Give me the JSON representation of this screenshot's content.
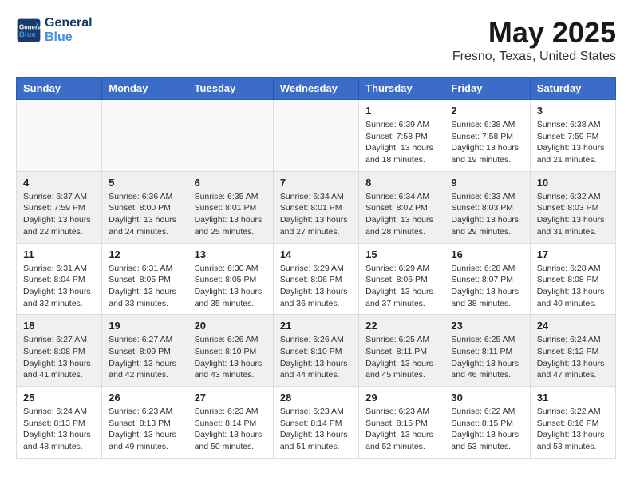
{
  "header": {
    "logo_line1": "General",
    "logo_line2": "Blue",
    "title": "May 2025",
    "subtitle": "Fresno, Texas, United States"
  },
  "weekdays": [
    "Sunday",
    "Monday",
    "Tuesday",
    "Wednesday",
    "Thursday",
    "Friday",
    "Saturday"
  ],
  "weeks": [
    [
      {
        "day": "",
        "info": ""
      },
      {
        "day": "",
        "info": ""
      },
      {
        "day": "",
        "info": ""
      },
      {
        "day": "",
        "info": ""
      },
      {
        "day": "1",
        "info": "Sunrise: 6:39 AM\nSunset: 7:58 PM\nDaylight: 13 hours\nand 18 minutes."
      },
      {
        "day": "2",
        "info": "Sunrise: 6:38 AM\nSunset: 7:58 PM\nDaylight: 13 hours\nand 19 minutes."
      },
      {
        "day": "3",
        "info": "Sunrise: 6:38 AM\nSunset: 7:59 PM\nDaylight: 13 hours\nand 21 minutes."
      }
    ],
    [
      {
        "day": "4",
        "info": "Sunrise: 6:37 AM\nSunset: 7:59 PM\nDaylight: 13 hours\nand 22 minutes."
      },
      {
        "day": "5",
        "info": "Sunrise: 6:36 AM\nSunset: 8:00 PM\nDaylight: 13 hours\nand 24 minutes."
      },
      {
        "day": "6",
        "info": "Sunrise: 6:35 AM\nSunset: 8:01 PM\nDaylight: 13 hours\nand 25 minutes."
      },
      {
        "day": "7",
        "info": "Sunrise: 6:34 AM\nSunset: 8:01 PM\nDaylight: 13 hours\nand 27 minutes."
      },
      {
        "day": "8",
        "info": "Sunrise: 6:34 AM\nSunset: 8:02 PM\nDaylight: 13 hours\nand 28 minutes."
      },
      {
        "day": "9",
        "info": "Sunrise: 6:33 AM\nSunset: 8:03 PM\nDaylight: 13 hours\nand 29 minutes."
      },
      {
        "day": "10",
        "info": "Sunrise: 6:32 AM\nSunset: 8:03 PM\nDaylight: 13 hours\nand 31 minutes."
      }
    ],
    [
      {
        "day": "11",
        "info": "Sunrise: 6:31 AM\nSunset: 8:04 PM\nDaylight: 13 hours\nand 32 minutes."
      },
      {
        "day": "12",
        "info": "Sunrise: 6:31 AM\nSunset: 8:05 PM\nDaylight: 13 hours\nand 33 minutes."
      },
      {
        "day": "13",
        "info": "Sunrise: 6:30 AM\nSunset: 8:05 PM\nDaylight: 13 hours\nand 35 minutes."
      },
      {
        "day": "14",
        "info": "Sunrise: 6:29 AM\nSunset: 8:06 PM\nDaylight: 13 hours\nand 36 minutes."
      },
      {
        "day": "15",
        "info": "Sunrise: 6:29 AM\nSunset: 8:06 PM\nDaylight: 13 hours\nand 37 minutes."
      },
      {
        "day": "16",
        "info": "Sunrise: 6:28 AM\nSunset: 8:07 PM\nDaylight: 13 hours\nand 38 minutes."
      },
      {
        "day": "17",
        "info": "Sunrise: 6:28 AM\nSunset: 8:08 PM\nDaylight: 13 hours\nand 40 minutes."
      }
    ],
    [
      {
        "day": "18",
        "info": "Sunrise: 6:27 AM\nSunset: 8:08 PM\nDaylight: 13 hours\nand 41 minutes."
      },
      {
        "day": "19",
        "info": "Sunrise: 6:27 AM\nSunset: 8:09 PM\nDaylight: 13 hours\nand 42 minutes."
      },
      {
        "day": "20",
        "info": "Sunrise: 6:26 AM\nSunset: 8:10 PM\nDaylight: 13 hours\nand 43 minutes."
      },
      {
        "day": "21",
        "info": "Sunrise: 6:26 AM\nSunset: 8:10 PM\nDaylight: 13 hours\nand 44 minutes."
      },
      {
        "day": "22",
        "info": "Sunrise: 6:25 AM\nSunset: 8:11 PM\nDaylight: 13 hours\nand 45 minutes."
      },
      {
        "day": "23",
        "info": "Sunrise: 6:25 AM\nSunset: 8:11 PM\nDaylight: 13 hours\nand 46 minutes."
      },
      {
        "day": "24",
        "info": "Sunrise: 6:24 AM\nSunset: 8:12 PM\nDaylight: 13 hours\nand 47 minutes."
      }
    ],
    [
      {
        "day": "25",
        "info": "Sunrise: 6:24 AM\nSunset: 8:13 PM\nDaylight: 13 hours\nand 48 minutes."
      },
      {
        "day": "26",
        "info": "Sunrise: 6:23 AM\nSunset: 8:13 PM\nDaylight: 13 hours\nand 49 minutes."
      },
      {
        "day": "27",
        "info": "Sunrise: 6:23 AM\nSunset: 8:14 PM\nDaylight: 13 hours\nand 50 minutes."
      },
      {
        "day": "28",
        "info": "Sunrise: 6:23 AM\nSunset: 8:14 PM\nDaylight: 13 hours\nand 51 minutes."
      },
      {
        "day": "29",
        "info": "Sunrise: 6:23 AM\nSunset: 8:15 PM\nDaylight: 13 hours\nand 52 minutes."
      },
      {
        "day": "30",
        "info": "Sunrise: 6:22 AM\nSunset: 8:15 PM\nDaylight: 13 hours\nand 53 minutes."
      },
      {
        "day": "31",
        "info": "Sunrise: 6:22 AM\nSunset: 8:16 PM\nDaylight: 13 hours\nand 53 minutes."
      }
    ]
  ]
}
